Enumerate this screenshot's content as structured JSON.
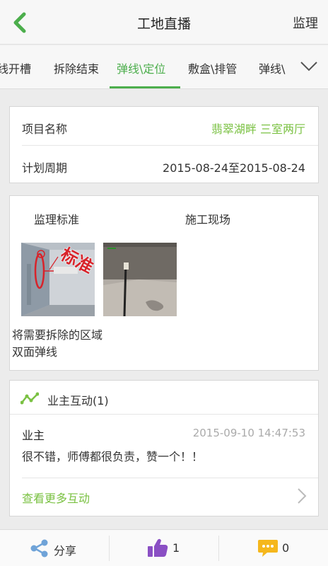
{
  "header": {
    "title": "工地直播",
    "right_label": "监理",
    "accent_color": "#4cae4c"
  },
  "tabs": [
    {
      "label": "管线开槽"
    },
    {
      "label": "拆除结束"
    },
    {
      "label": "弹线\\定位",
      "active": true
    },
    {
      "label": "敷盒\\排管"
    },
    {
      "label": "弹线\\"
    }
  ],
  "project": {
    "name_label": "项目名称",
    "name_value": "翡翠湖畔 三室两厅",
    "period_label": "计划周期",
    "period_value": "2015-08-24至2015-08-24"
  },
  "standard": {
    "std_heading": "监理标准",
    "site_heading": "施工现场",
    "stamp_text": "标准",
    "description": "将需要拆除的区域双面弹线"
  },
  "interaction": {
    "title": "业主互动(1)",
    "comment_user": "业主",
    "comment_time": "2015-09-10 14:47:53",
    "comment_text": "很不错，师傅都很负责，赞一个！！",
    "more_label": "查看更多互动"
  },
  "bottom": {
    "share_label": "分享",
    "like_count": "1",
    "comment_count": "0"
  }
}
